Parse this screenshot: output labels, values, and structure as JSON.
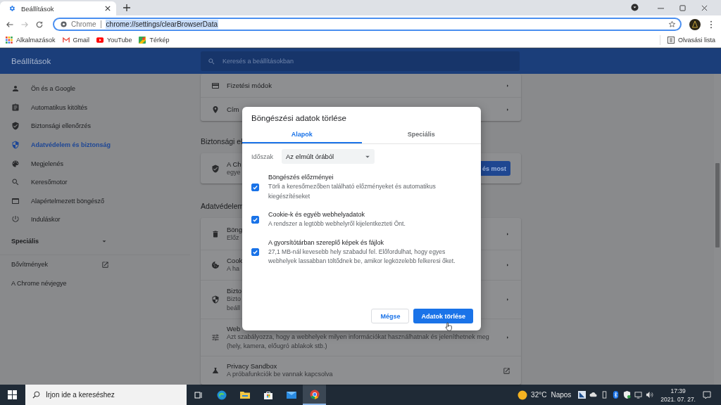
{
  "browser_tabs": [
    {
      "title": "Beállítások",
      "selected": true
    }
  ],
  "address_bar": {
    "origin": "Chrome",
    "url": "chrome://settings/clearBrowserData",
    "url_selected": true
  },
  "bookmarks": [
    {
      "label": "Alkalmazások"
    },
    {
      "label": "Gmail"
    },
    {
      "label": "YouTube"
    },
    {
      "label": "Térkép"
    }
  ],
  "reading_list": "Olvasási lista",
  "settings": {
    "title": "Beállítások",
    "search_placeholder": "Keresés a beállításokban",
    "nav": [
      {
        "label": "Ön és a Google",
        "selected": false
      },
      {
        "label": "Automatikus kitöltés",
        "selected": false
      },
      {
        "label": "Biztonsági ellenőrzés",
        "selected": false
      },
      {
        "label": "Adatvédelem és biztonság",
        "selected": true
      },
      {
        "label": "Megjelenés",
        "selected": false
      },
      {
        "label": "Keresőmotor",
        "selected": false
      },
      {
        "label": "Alapértelmezett böngésző",
        "selected": false
      },
      {
        "label": "Induláskor",
        "selected": false
      }
    ],
    "advanced": {
      "label": "Speciális",
      "expanded": false
    },
    "links": [
      {
        "label": "Bővítmények",
        "external": true
      },
      {
        "label": "A Chrome névjegye",
        "external": false
      }
    ],
    "autofill_rows": [
      {
        "title": "Fizetési módok"
      },
      {
        "title": "Cím"
      }
    ],
    "safety_heading": "Biztonsági el",
    "safety_card": {
      "lines": [
        "A Ch",
        "egye"
      ],
      "button": "és most"
    },
    "privacy_heading": "Adatvédelem",
    "privacy_rows": [
      {
        "lines": [
          "Böng",
          "Előz"
        ],
        "external": false
      },
      {
        "lines": [
          "Cook",
          "A ha"
        ],
        "external": false
      },
      {
        "lines": [
          "Bizto",
          "Bizto",
          "beáll"
        ],
        "external": false
      },
      {
        "lines": [
          "Web",
          "Azt szabályozza, hogy a webhelyek milyen információkat használhatnak és jeleníthetnek meg",
          "(hely, kamera, előugró ablakok stb.)"
        ],
        "external": false
      },
      {
        "lines": [
          "Privacy Sandbox",
          "A próbafunkciók be vannak kapcsolva"
        ],
        "external": true
      }
    ]
  },
  "dialog": {
    "title": "Böngészési adatok törlése",
    "tabs": [
      {
        "label": "Alapok",
        "selected": true
      },
      {
        "label": "Speciális",
        "selected": false
      }
    ],
    "period": {
      "label": "Időszak",
      "value": "Az elmúlt órából"
    },
    "options": [
      {
        "title": "Böngészés előzményei",
        "description": "Törli a keresőmezőben található előzményeket és automatikus kiegészítéseket",
        "checked": true
      },
      {
        "title": "Cookie-k és egyéb webhelyadatok",
        "description": "A rendszer a legtöbb webhelyről kijelentkezteti Önt.",
        "checked": true
      },
      {
        "title": "A gyorsítótárban szereplő képek és fájlok",
        "description": "27,1 MB-nál kevesebb hely szabadul fel. Előfordulhat, hogy egyes webhelyek lassabban töltődnek be, amikor legközelebb felkeresi őket.",
        "checked": true
      }
    ],
    "cancel_button": "Mégse",
    "confirm_button": "Adatok törlése"
  },
  "taskbar": {
    "search_placeholder": "Írjon ide a kereséshez",
    "apps": [
      {
        "active": false
      },
      {
        "active": false
      },
      {
        "active": false
      },
      {
        "active": false
      },
      {
        "active": false
      },
      {
        "active": true
      }
    ],
    "weather": {
      "temperature": "32°C",
      "condition": "Napos"
    },
    "time": "17:39",
    "date": "2021. 07. 27."
  }
}
